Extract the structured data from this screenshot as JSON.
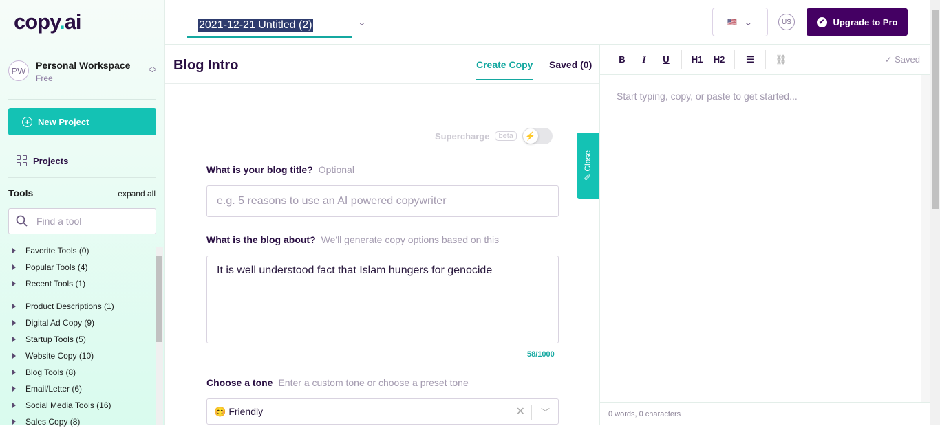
{
  "logo": {
    "text1": "copy",
    "text2": "ai"
  },
  "workspace": {
    "initials": "PW",
    "name": "Personal Workspace",
    "plan": "Free"
  },
  "sidebar": {
    "new_project": "New Project",
    "projects": "Projects",
    "tools_heading": "Tools",
    "expand_all": "expand all",
    "find_placeholder": "Find a tool",
    "tool_groups": [
      [
        "Favorite Tools (0)",
        "Popular Tools (4)",
        "Recent Tools (1)"
      ],
      [
        "Product Descriptions (1)",
        "Digital Ad Copy (9)",
        "Startup Tools (5)",
        "Website Copy (10)",
        "Blog Tools (8)",
        "Email/Letter (6)",
        "Social Media Tools (16)",
        "Sales Copy (8)"
      ]
    ]
  },
  "header": {
    "doc_title": "2021-12-21 Untitled (2)",
    "flag": "🇺🇸",
    "user_initials": "US",
    "upgrade": "Upgrade to Pro"
  },
  "main": {
    "title": "Blog Intro",
    "tabs": [
      "Create Copy",
      "Saved (0)"
    ],
    "supercharge": "Supercharge",
    "beta": "beta",
    "blog_title_label": "What is your blog title?",
    "blog_title_hint": "Optional",
    "blog_title_placeholder": "e.g. 5 reasons to use an AI powered copywriter",
    "about_label": "What is the blog about?",
    "about_hint": "We'll generate copy options based on this",
    "about_value": "It is well understood fact that Islam hungers for genocide",
    "char_count": "58/1000",
    "tone_label": "Choose a tone",
    "tone_hint": "Enter a custom tone or choose a preset tone",
    "tone_value": "😊 Friendly",
    "close_tab": "Close"
  },
  "editor": {
    "buttons": [
      "B",
      "I",
      "U",
      "H1",
      "H2"
    ],
    "saved": "Saved",
    "placeholder": "Start typing, copy, or paste to get started...",
    "footer": "0 words, 0 characters"
  },
  "colors": {
    "accent": "#14c2b4",
    "brand": "#440063"
  }
}
